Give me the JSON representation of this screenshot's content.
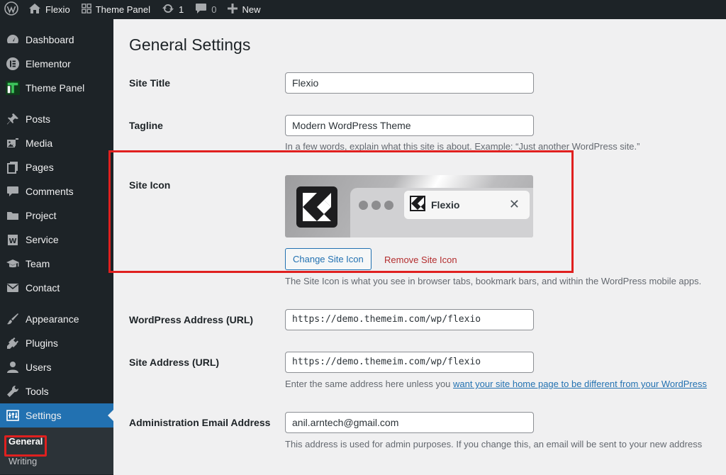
{
  "adminbar": {
    "site_name": "Flexio",
    "theme_panel": "Theme Panel",
    "updates_count": "1",
    "comments_count": "0",
    "new_label": "New"
  },
  "sidebar": {
    "items": [
      {
        "label": "Dashboard",
        "icon": "dashboard-icon"
      },
      {
        "label": "Elementor",
        "icon": "elementor-icon"
      },
      {
        "label": "Theme Panel",
        "icon": "theme-panel-icon"
      },
      {
        "label": "Posts",
        "icon": "pin-icon"
      },
      {
        "label": "Media",
        "icon": "media-icon"
      },
      {
        "label": "Pages",
        "icon": "pages-icon"
      },
      {
        "label": "Comments",
        "icon": "comment-icon"
      },
      {
        "label": "Project",
        "icon": "folder-icon"
      },
      {
        "label": "Service",
        "icon": "service-icon"
      },
      {
        "label": "Team",
        "icon": "team-icon"
      },
      {
        "label": "Contact",
        "icon": "mail-icon"
      },
      {
        "label": "Appearance",
        "icon": "brush-icon"
      },
      {
        "label": "Plugins",
        "icon": "plugin-icon"
      },
      {
        "label": "Users",
        "icon": "user-icon"
      },
      {
        "label": "Tools",
        "icon": "wrench-icon"
      },
      {
        "label": "Settings",
        "icon": "settings-icon"
      }
    ],
    "submenu": [
      {
        "label": "General"
      },
      {
        "label": "Writing"
      }
    ]
  },
  "page": {
    "title": "General Settings",
    "site_title_label": "Site Title",
    "site_title_value": "Flexio",
    "tagline_label": "Tagline",
    "tagline_value": "Modern WordPress Theme",
    "tagline_desc": "In a few words, explain what this site is about. Example: “Just another WordPress site.”",
    "site_icon_label": "Site Icon",
    "preview_tab_title": "Flexio",
    "change_icon_button": "Change Site Icon",
    "remove_icon_button": "Remove Site Icon",
    "site_icon_desc": "The Site Icon is what you see in browser tabs, bookmark bars, and within the WordPress mobile apps.",
    "wp_address_label": "WordPress Address (URL)",
    "wp_address_value": "https://demo.themeim.com/wp/flexio",
    "site_address_label": "Site Address (URL)",
    "site_address_value": "https://demo.themeim.com/wp/flexio",
    "site_address_desc_prefix": "Enter the same address here unless you ",
    "site_address_desc_link": "want your site home page to be different from your WordPress",
    "admin_email_label": "Administration Email Address",
    "admin_email_value": "anil.arntech@gmail.com",
    "admin_email_desc": "This address is used for admin purposes. If you change this, an email will be sent to your new address"
  },
  "colors": {
    "accent": "#2271b1",
    "highlight": "#e0201f",
    "danger": "#b32d2e"
  }
}
